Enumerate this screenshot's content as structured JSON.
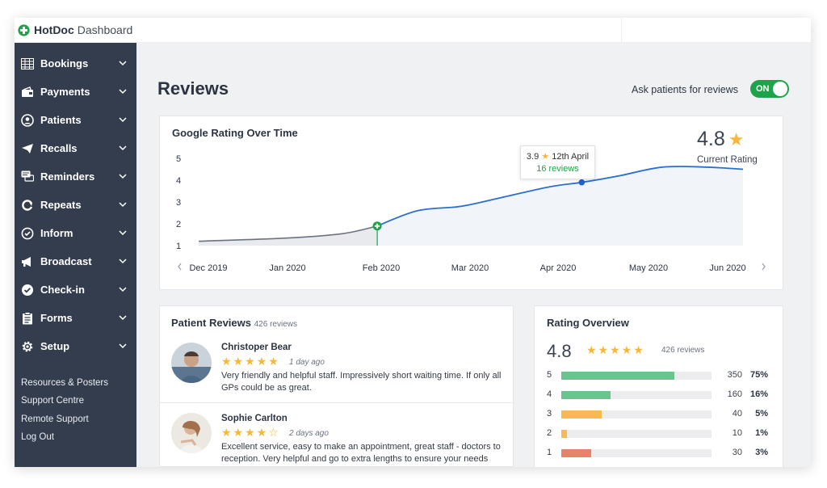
{
  "app": {
    "brand": "HotDoc",
    "section": "Dashboard"
  },
  "sidebar": {
    "items": [
      {
        "label": "Bookings",
        "icon": "calendar-grid-icon"
      },
      {
        "label": "Payments",
        "icon": "wallet-icon"
      },
      {
        "label": "Patients",
        "icon": "user-circle-icon"
      },
      {
        "label": "Recalls",
        "icon": "paper-plane-icon"
      },
      {
        "label": "Reminders",
        "icon": "chat-bubbles-icon"
      },
      {
        "label": "Repeats",
        "icon": "repeat-icon"
      },
      {
        "label": "Inform",
        "icon": "inform-icon"
      },
      {
        "label": "Broadcast",
        "icon": "megaphone-icon"
      },
      {
        "label": "Check-in",
        "icon": "check-circle-icon"
      },
      {
        "label": "Forms",
        "icon": "clipboard-icon"
      },
      {
        "label": "Setup",
        "icon": "gear-icon"
      }
    ],
    "links": [
      "Resources & Posters",
      "Support Centre",
      "Remote Support",
      "Log Out"
    ]
  },
  "header": {
    "title": "Reviews",
    "ask_label": "Ask patients for reviews",
    "toggle_label": "ON",
    "toggle_on": true
  },
  "rating_chart": {
    "title": "Google Rating Over Time",
    "current_rating": "4.8",
    "current_label": "Current Rating",
    "tooltip": {
      "rating": "3.9",
      "date": "12th April",
      "reviews": "16 reviews"
    },
    "colors": {
      "line_before": "#6b7280",
      "line_after": "#2b6fd0",
      "marker_green": "#1ea34a",
      "marker_blue": "#1e64d0"
    }
  },
  "chart_data": {
    "type": "area",
    "title": "Google Rating Over Time",
    "xlabel": "",
    "ylabel": "",
    "y_ticks": [
      1,
      2,
      3,
      4,
      5
    ],
    "ylim": [
      1,
      5
    ],
    "x_ticks": [
      "Dec 2019",
      "Jan 2020",
      "Feb 2020",
      "Mar 2020",
      "Apr 2020",
      "May 2020",
      "Jun 2020"
    ],
    "grid": false,
    "series": [
      {
        "x": [
          "2019-12-01",
          "2020-01-01",
          "2020-01-20",
          "2020-02-01",
          "2020-02-15",
          "2020-03-01",
          "2020-03-15",
          "2020-04-01",
          "2020-04-12",
          "2020-04-25",
          "2020-05-10",
          "2020-05-25",
          "2020-06-07"
        ],
        "values": [
          1.2,
          1.35,
          1.55,
          1.9,
          2.6,
          2.8,
          3.2,
          3.7,
          3.9,
          4.2,
          4.6,
          4.6,
          4.5
        ]
      }
    ],
    "highlight_points": [
      {
        "x": "2020-02-01",
        "y": 1.9,
        "marker": "green-cross"
      },
      {
        "x": "2020-04-12",
        "y": 3.9,
        "marker": "blue-dot"
      }
    ]
  },
  "patient_reviews": {
    "title": "Patient Reviews",
    "count_label": "426 reviews",
    "items": [
      {
        "name": "Christoper Bear",
        "rating": 5,
        "stars_text": "★★★★★",
        "ago": "1 day ago",
        "text": "Very friendly and helpful staff. Impressively short waiting time. If only all GPs could be as great."
      },
      {
        "name": "Sophie Carlton",
        "rating": 4,
        "stars_text": "★★★★☆",
        "ago": "2 days ago",
        "text": "Excellent service, easy to make an appointment, great staff - doctors to reception. Very helpful and go to extra lengths to ensure your needs can be fulfilled."
      }
    ]
  },
  "rating_overview": {
    "title": "Rating Overview",
    "average": "4.8",
    "stars_text": "★★★★★",
    "count_label": "426 reviews",
    "rows": [
      {
        "star": "5",
        "count": "350",
        "pct": "75%",
        "fraction": 0.75,
        "color": "#6cc38e"
      },
      {
        "star": "4",
        "count": "160",
        "pct": "16%",
        "fraction": 0.33,
        "color": "#6cc38e"
      },
      {
        "star": "3",
        "count": "40",
        "pct": "5%",
        "fraction": 0.27,
        "color": "#f6b955"
      },
      {
        "star": "2",
        "count": "10",
        "pct": "1%",
        "fraction": 0.04,
        "color": "#f6b955"
      },
      {
        "star": "1",
        "count": "30",
        "pct": "3%",
        "fraction": 0.2,
        "color": "#e6836b"
      }
    ]
  }
}
